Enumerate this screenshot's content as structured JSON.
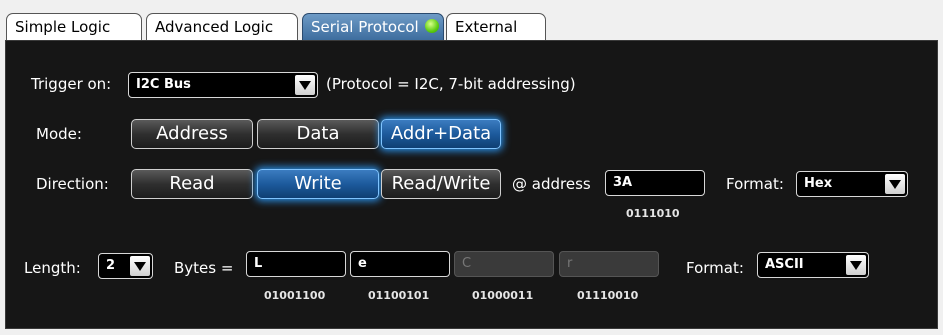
{
  "tabs": [
    {
      "label": "Simple Logic"
    },
    {
      "label": "Advanced Logic"
    },
    {
      "label": "Serial Protocol",
      "status_icon": "green-status-dot",
      "active": true
    },
    {
      "label": "External"
    }
  ],
  "trigger": {
    "label": "Trigger on:",
    "value": "I2C Bus",
    "note": "(Protocol = I2C, 7-bit addressing)"
  },
  "mode": {
    "label": "Mode:",
    "options": [
      "Address",
      "Data",
      "Addr+Data"
    ],
    "selected": "Addr+Data"
  },
  "direction": {
    "label": "Direction:",
    "options": [
      "Read",
      "Write",
      "Read/Write"
    ],
    "selected": "Write",
    "address_label": "@ address",
    "address_value": "3A",
    "address_binary": "0111010",
    "format_label": "Format:",
    "format_value": "Hex"
  },
  "length": {
    "label": "Length:",
    "value": "2",
    "bytes_label": "Bytes =",
    "bytes": [
      {
        "value": "L",
        "binary": "01001100",
        "enabled": true
      },
      {
        "value": "e",
        "binary": "01100101",
        "enabled": true
      },
      {
        "value": "C",
        "binary": "01000011",
        "enabled": false
      },
      {
        "value": "r",
        "binary": "01110010",
        "enabled": false
      }
    ],
    "format_label": "Format:",
    "format_value": "ASCII"
  },
  "colors": {
    "panel_bg": "#161616",
    "selected_glow": "#2b8fe6",
    "status_dot": "#5ccc10"
  }
}
